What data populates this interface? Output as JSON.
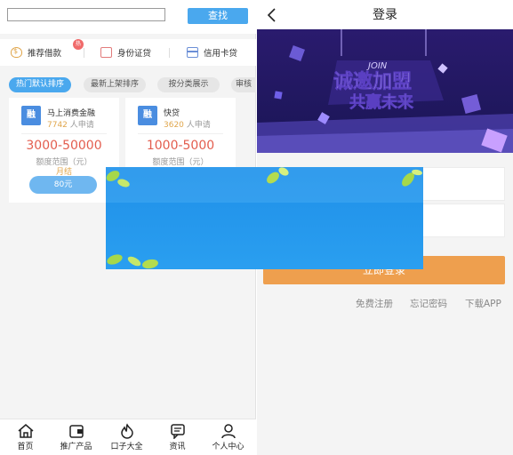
{
  "left": {
    "search": {
      "placeholder": "",
      "button": "查找"
    },
    "categories": [
      {
        "label": "推荐借款",
        "icon": "money-bag-icon",
        "badge": "热"
      },
      {
        "label": "身份证贷",
        "icon": "id-card-icon"
      },
      {
        "label": "信用卡贷",
        "icon": "credit-card-icon"
      }
    ],
    "tabs": [
      "热门默认排序",
      "最新上架排序",
      "按分类展示",
      "审核"
    ],
    "products": [
      {
        "logo": "融",
        "name": "马上消费金融",
        "count": "7742",
        "count_suffix": "人申请",
        "range": "3000-50000",
        "range_label": "额度范围（元）",
        "term": "月结",
        "fee": "80元"
      },
      {
        "logo": "融",
        "name": "快贷",
        "count": "3620",
        "count_suffix": "人申请",
        "range": "1000-5000",
        "range_label": "额度范围（元）"
      }
    ],
    "nav": [
      {
        "label": "首页",
        "icon": "home-icon"
      },
      {
        "label": "推广产品",
        "icon": "wallet-icon"
      },
      {
        "label": "口子大全",
        "icon": "flame-icon"
      },
      {
        "label": "资讯",
        "icon": "chat-icon"
      },
      {
        "label": "个人中心",
        "icon": "user-icon"
      }
    ]
  },
  "right": {
    "title": "登录",
    "banner": {
      "line1": "诚邀加盟",
      "line2": "共赢未来",
      "tag": "JOIN"
    },
    "login_button": "立即登录",
    "links": [
      "免费注册",
      "忘记密码",
      "下载APP"
    ]
  },
  "colors": {
    "accent": "#4aa8ee",
    "login": "#ee9f4e",
    "price": "#e35d4e"
  }
}
